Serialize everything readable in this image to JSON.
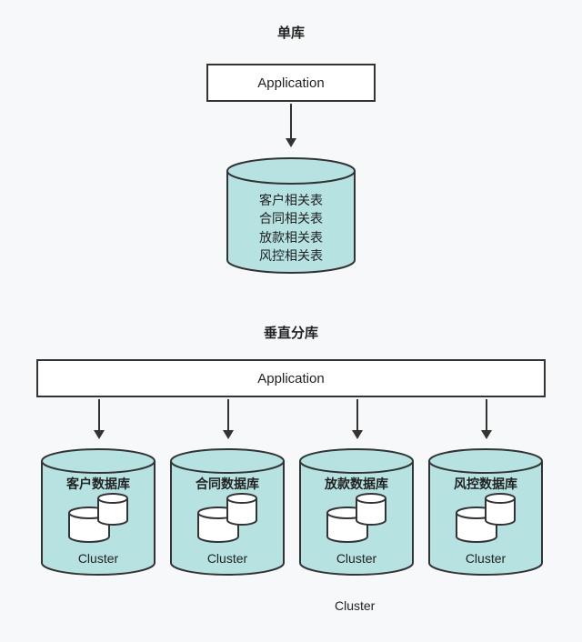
{
  "top": {
    "title": "单库",
    "app_label": "Application",
    "db_lines": [
      "客户相关表",
      "合同相关表",
      "放款相关表",
      "风控相关表"
    ]
  },
  "bottom": {
    "title": "垂直分库",
    "app_label": "Application",
    "dbs": [
      {
        "name": "客户数据库",
        "foot": "Cluster"
      },
      {
        "name": "合同数据库",
        "foot": "Cluster"
      },
      {
        "name": "放款数据库",
        "foot": "Cluster"
      },
      {
        "name": "风控数据库",
        "foot": "Cluster"
      }
    ],
    "stray_label": "Cluster"
  },
  "colors": {
    "fill": "#b6e2e2",
    "stroke": "#333333",
    "inner": "#ffffff"
  }
}
